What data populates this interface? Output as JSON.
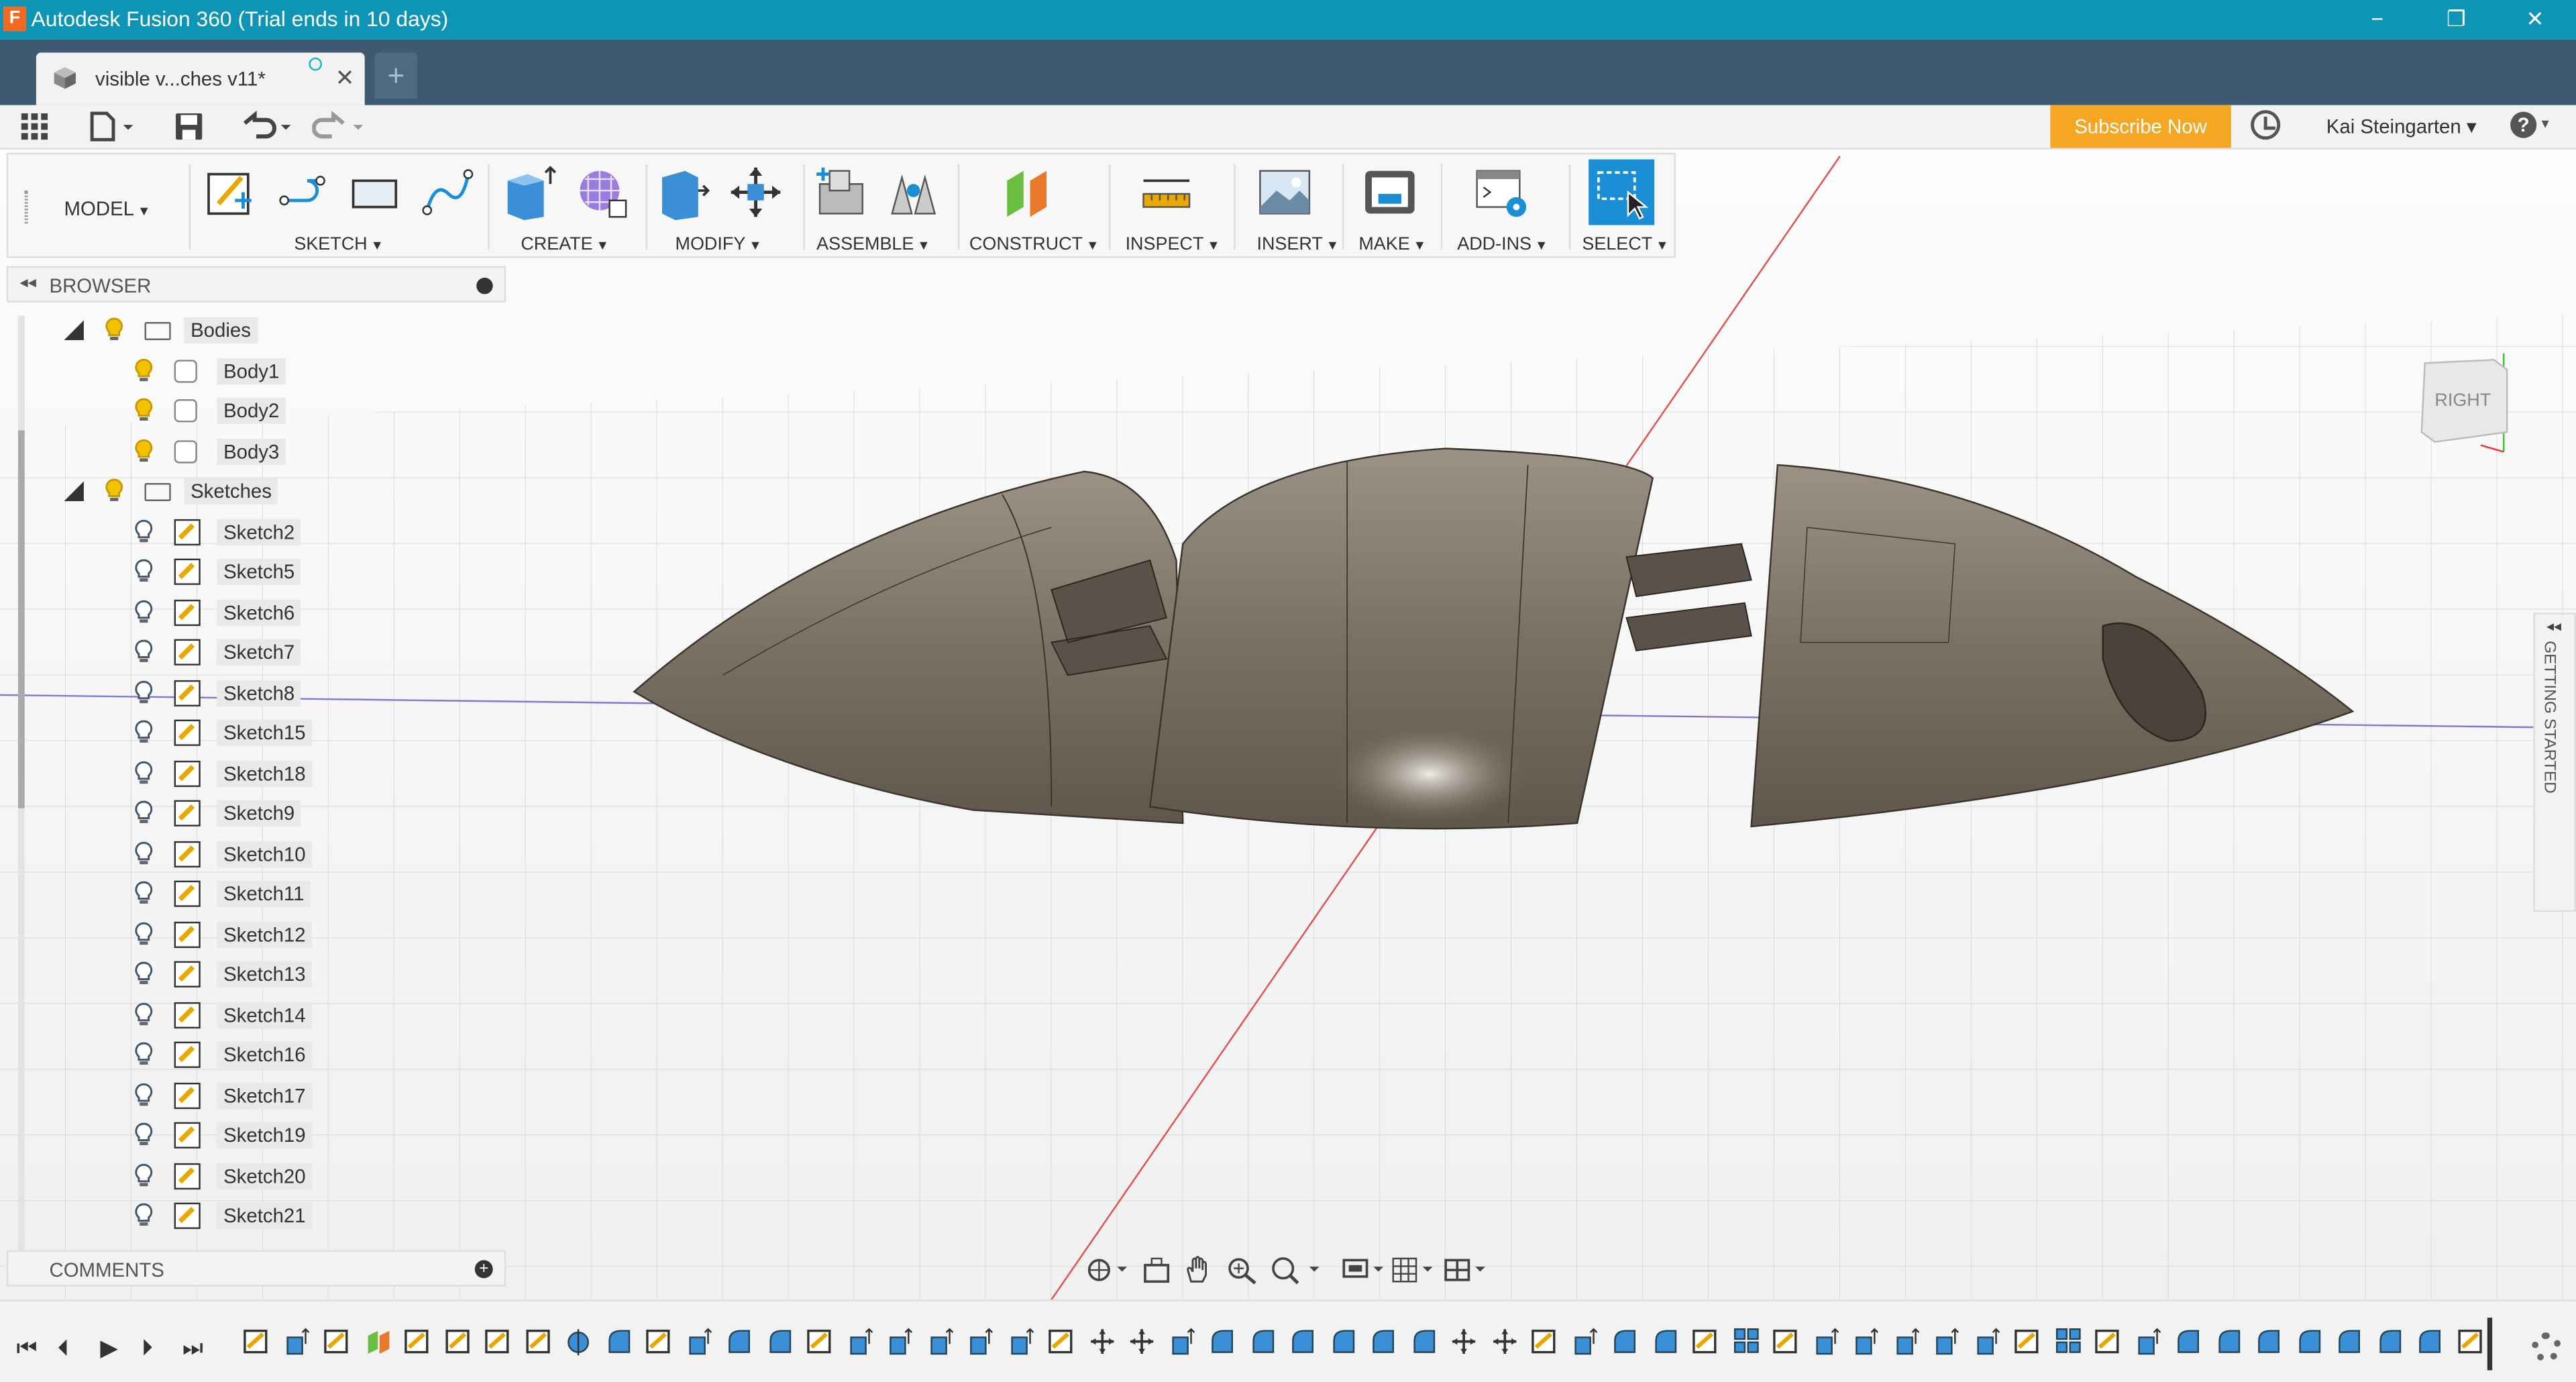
{
  "window": {
    "title": "Autodesk Fusion 360 (Trial ends in 10 days)",
    "app_icon": "F",
    "minimize": "−",
    "restore": "❐",
    "close": "✕"
  },
  "tabs": {
    "doc_title": "visible v...ches v11*",
    "close": "✕",
    "new_tab": "+"
  },
  "qat": {
    "subscribe": "Subscribe Now",
    "user": "Kai Steingarten"
  },
  "toolbar": {
    "workspace": "MODEL",
    "groups": [
      "SKETCH",
      "CREATE",
      "MODIFY",
      "ASSEMBLE",
      "CONSTRUCT",
      "INSPECT",
      "INSERT",
      "MAKE",
      "ADD-INS",
      "SELECT"
    ],
    "accent": "#1a8fd6"
  },
  "browser": {
    "title": "BROWSER",
    "bodies_folder": "Bodies",
    "bodies": [
      "Body1",
      "Body2",
      "Body3"
    ],
    "sketches_folder": "Sketches",
    "sketches": [
      "Sketch2",
      "Sketch5",
      "Sketch6",
      "Sketch7",
      "Sketch8",
      "Sketch15",
      "Sketch18",
      "Sketch9",
      "Sketch10",
      "Sketch11",
      "Sketch12",
      "Sketch13",
      "Sketch14",
      "Sketch16",
      "Sketch17",
      "Sketch19",
      "Sketch20",
      "Sketch21"
    ]
  },
  "comments": {
    "title": "COMMENTS"
  },
  "viewcube": {
    "face": "RIGHT"
  },
  "getting_started": "GETTING STARTED",
  "timeline": {
    "feature_count": 56
  },
  "colors": {
    "titlebar": "#0e95b5",
    "tabbar": "#3e5970",
    "subscribe": "#f5a623"
  }
}
